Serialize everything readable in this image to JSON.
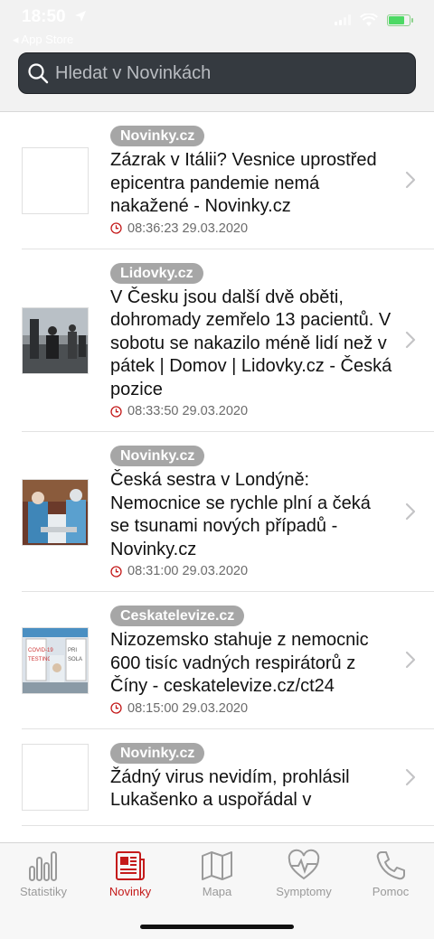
{
  "status_bar": {
    "time": "18:50",
    "back_label": "◂ App Store",
    "location_icon": "location-arrow-icon",
    "battery_color": "#4cd964",
    "battery_level": 0.7
  },
  "search": {
    "placeholder": "Hledat v Novinkách",
    "value": "",
    "icon": "search-icon"
  },
  "news": [
    {
      "source": "Novinky.cz",
      "title": "Zázrak v Itálii? Vesnice uprostřed epicentra pandemie nemá nakažené - Novinky.cz",
      "time": "08:36:23 29.03.2020",
      "thumbnail": "blank"
    },
    {
      "source": "Lidovky.cz",
      "title": "V Česku jsou další dvě oběti, dohromady zemřelo 13 pacientů. V sobotu se nakazilo méně lidí než v pátek | Domov | Lidovky.cz - Česká pozice",
      "time": "08:33:50 29.03.2020",
      "thumbnail": "photo-street"
    },
    {
      "source": "Novinky.cz",
      "title": "Česká sestra v Londýně: Nemocnice se rychle plní a čeká se tsunami nových případů - Novinky.cz",
      "time": "08:31:00 29.03.2020",
      "thumbnail": "photo-medical"
    },
    {
      "source": "Ceskatelevize.cz",
      "title": "Nizozemsko stahuje z nemocnic 600 tisíc vadných respirátorů z Číny - ceskatelevize.cz/ct24",
      "time": "08:15:00 29.03.2020",
      "thumbnail": "photo-testing"
    },
    {
      "source": "Novinky.cz",
      "title": "Žádný virus nevidím, prohlásil Lukašenko a uspořádal v",
      "time": "",
      "thumbnail": "blank"
    }
  ],
  "tabs": [
    {
      "label": "Statistiky",
      "icon": "bar-chart-icon",
      "active": false
    },
    {
      "label": "Novinky",
      "icon": "newspaper-icon",
      "active": true
    },
    {
      "label": "Mapa",
      "icon": "map-icon",
      "active": false
    },
    {
      "label": "Symptomy",
      "icon": "heart-pulse-icon",
      "active": false
    },
    {
      "label": "Pomoc",
      "icon": "phone-icon",
      "active": false
    }
  ],
  "colors": {
    "accent": "#c41a1a",
    "badge": "#a6a6a6",
    "search_bg": "#353a40",
    "inactive_tab": "#9a9a9a"
  }
}
